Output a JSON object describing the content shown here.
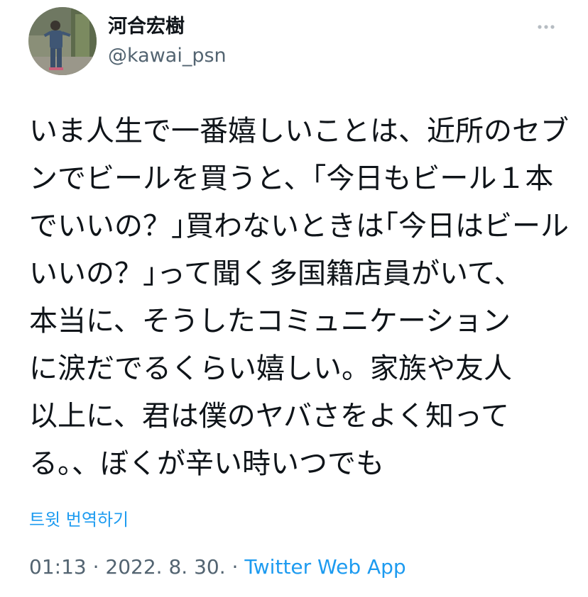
{
  "author": {
    "display_name": "河合宏樹",
    "handle": "@kawai_psn",
    "avatar_icon": "profile-photo"
  },
  "more_icon": "ellipsis-icon",
  "tweet": {
    "lines": [
      "いま人生で一番嬉しいことは、近所のセブ",
      "ンでビールを買うと、｢今日もビール１本",
      "でいいの？｣買わないときは｢今日はビール",
      "いいの？｣って聞く多国籍店員がいて、",
      "本当に、そうしたコミュニケーション",
      "に涙だでるくらい嬉しい。家族や友人",
      "以上に、君は僕のヤバさをよく知って",
      "る。、ぼくが辛い時いつでも"
    ]
  },
  "translate_link": "트윗 번역하기",
  "meta": {
    "time": "01:13",
    "separator": " · ",
    "date": "2022. 8. 30.",
    "source": "Twitter Web App"
  },
  "colors": {
    "text": "#0f1419",
    "secondary": "#536471",
    "link": "#1d9bf0"
  }
}
